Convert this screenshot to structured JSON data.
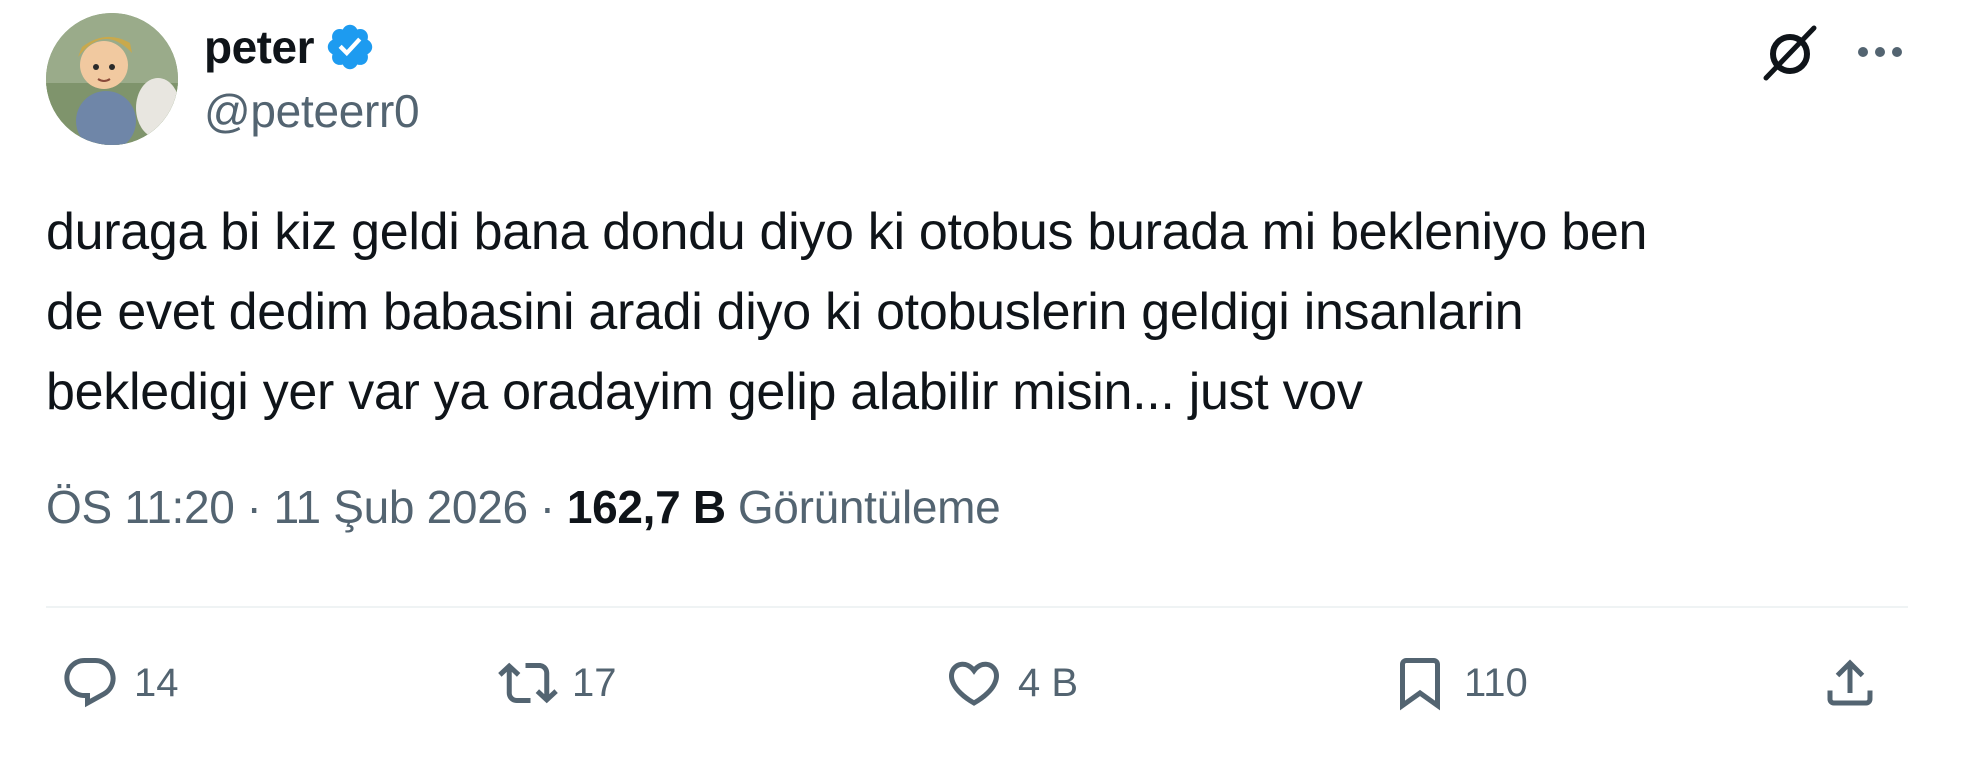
{
  "author": {
    "display_name": "peter",
    "handle": "@peteerr0",
    "verified": true,
    "verified_color": "#1d9bf0"
  },
  "header_actions": {
    "grok_icon": "grok-icon",
    "more_icon": "more-icon"
  },
  "tweet": {
    "text": "duraga bi kiz geldi bana dondu diyo ki otobus burada mi bekleniyo ben\nde evet dedim babasini aradi diyo ki otobuslerin geldigi insanlarin\nbekledigi yer var ya oradayim gelip alabilir misin... just vov"
  },
  "meta": {
    "time": "ÖS 11:20",
    "separator": "·",
    "date": "11 Şub 2026",
    "views_count": "162,7 B",
    "views_label": "Görüntüleme"
  },
  "actions": {
    "replies": "14",
    "retweets": "17",
    "likes": "4 B",
    "bookmarks": "110"
  },
  "colors": {
    "text": "#0f1419",
    "secondary": "#536471",
    "divider": "#eff3f4"
  }
}
